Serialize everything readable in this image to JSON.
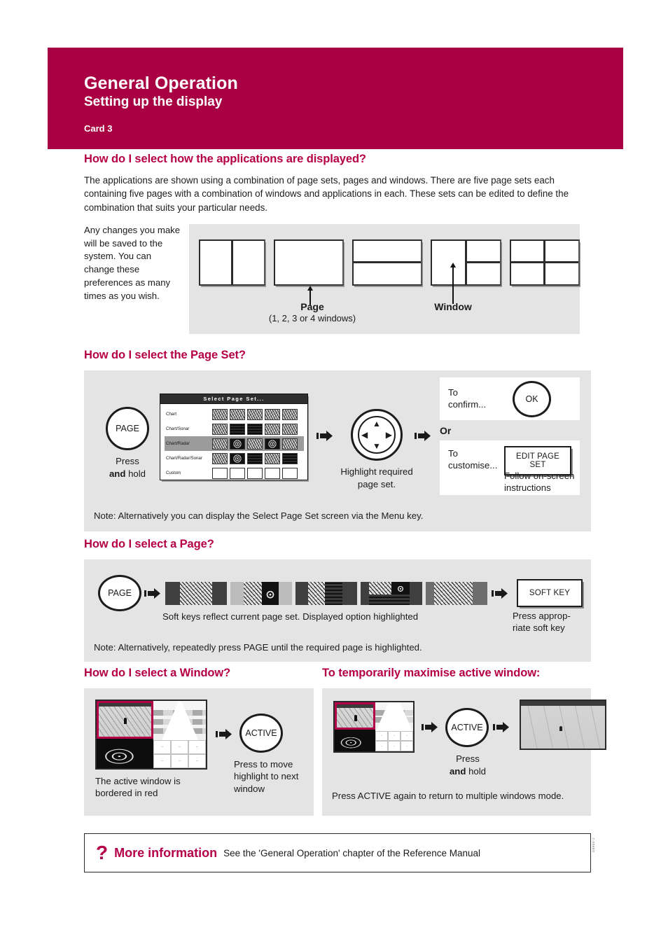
{
  "header": {
    "title": "General Operation",
    "subtitle": "Setting up the display",
    "card": "Card 3",
    "brand_color": "#a80042"
  },
  "section_displayed": {
    "heading": "How do I select how the applications are displayed?",
    "body": "The applications are shown using a combination of page sets, pages and windows. There are five page sets each containing five pages with a combination of windows and applications in each.  These sets can be edited to define the combination that suits your particular needs.",
    "side_note": "Any changes you make will be saved to the system. You can change these preferences as many times as you wish.",
    "page_label": "Page",
    "page_sub": "(1, 2, 3 or 4 windows)",
    "window_label": "Window"
  },
  "section_page_set": {
    "heading": "How do I select the Page Set?",
    "key_label": "PAGE",
    "key_press": "Press",
    "key_press_bold": "and",
    "key_press_tail": " hold",
    "dialog": {
      "title": "Select Page Set...",
      "rows": [
        {
          "label": "Chart",
          "selected": false
        },
        {
          "label": "Chart/Sonar",
          "selected": false
        },
        {
          "label": "Chart/Radar",
          "selected": true
        },
        {
          "label": "Chart/Radar/Sonar",
          "selected": false
        },
        {
          "label": "Custom",
          "selected": false
        }
      ]
    },
    "trackpad_caption": "Highlight required page set.",
    "confirm_label": "To confirm...",
    "ok_label": "OK",
    "or_label": "Or",
    "customise_label": "To customise...",
    "edit_button": "EDIT PAGE SET",
    "follow_text": "Follow on-screen instructions",
    "note": "Note:  Alternatively you can display the Select Page Set screen via the Menu key."
  },
  "section_page": {
    "heading": "How do I select a Page?",
    "key_label": "PAGE",
    "softkeys": [
      {
        "type": "chart",
        "highlighted": false
      },
      {
        "type": "chart-radar",
        "highlighted": true
      },
      {
        "type": "chart-sonar",
        "highlighted": false
      },
      {
        "type": "chart-radar-sonar",
        "highlighted": false
      },
      {
        "type": "chart-wide",
        "highlighted": false
      }
    ],
    "softkey_caption": "Soft keys reflect current page set.  Displayed option highlighted",
    "soft_key_button": "SOFT KEY",
    "press_caption": "Press approp-riate soft key",
    "note": "Note:  Alternatively, repeatedly press PAGE until the required page is highlighted."
  },
  "section_window": {
    "heading": "How do I select a Window?",
    "active_label": "ACTIVE",
    "press_caption": "Press to move highlight to next window",
    "window_caption": "The active window is bordered in red",
    "active_border_color": "#b5004a"
  },
  "section_maximise": {
    "heading": "To temporarily maximise active window:",
    "active_label": "ACTIVE",
    "press": "Press",
    "press_bold": "and",
    "press_tail": " hold",
    "note": "Press ACTIVE again to return to multiple windows mode."
  },
  "footer": {
    "question_mark": "?",
    "more_info": "More information",
    "see_text": "See the 'General Operation' chapter of the Reference Manual",
    "doc_code": "D8900-2"
  }
}
